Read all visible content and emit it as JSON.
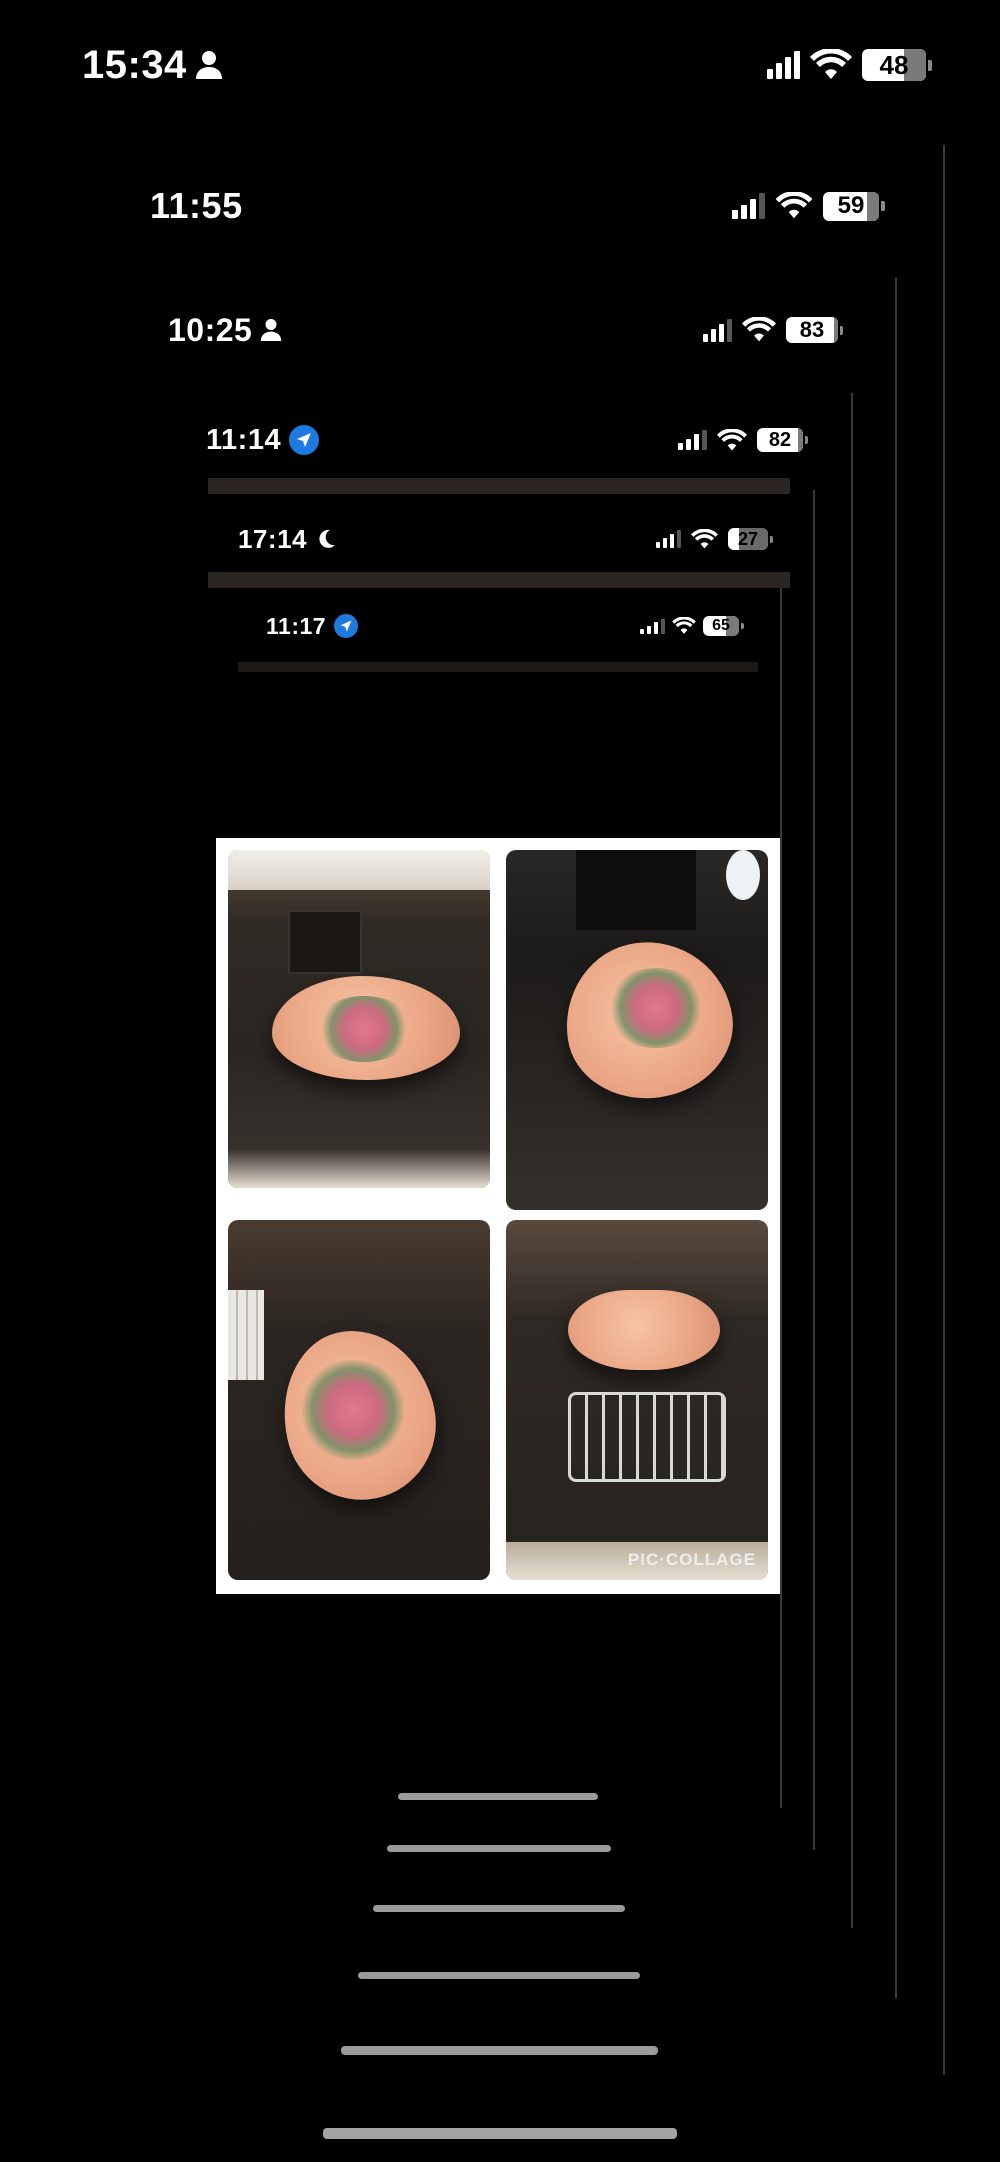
{
  "status_bars": [
    {
      "time": "15:34",
      "icon": "person-icon",
      "battery": "48",
      "battery_fill": 0.48
    },
    {
      "time": "11:55",
      "icon": "",
      "battery": "59",
      "battery_fill": 0.59
    },
    {
      "time": "10:25",
      "icon": "person-icon",
      "battery": "83",
      "battery_fill": 0.83
    },
    {
      "time": "11:14",
      "icon": "location-arrow-icon",
      "battery": "82",
      "battery_fill": 0.82
    },
    {
      "time": "17:14",
      "icon": "moon-icon",
      "battery": "27",
      "battery_fill": 0.27
    },
    {
      "time": "11:17",
      "icon": "location-arrow-icon",
      "battery": "65",
      "battery_fill": 0.65
    }
  ],
  "collage": {
    "watermark": "PIC·COLLAGE",
    "photos": [
      {
        "subject": "terracotta pig-shaped dish with floral painting on dark table"
      },
      {
        "subject": "terracotta pig-shaped dish viewed from side on dark table"
      },
      {
        "subject": "terracotta pig-shaped dish near radiator"
      },
      {
        "subject": "terracotta pig-shaped dish with wire rack stand"
      }
    ]
  },
  "colors": {
    "background": "#000000",
    "location_blue": "#1f7ae0",
    "plate": "#eba887"
  }
}
